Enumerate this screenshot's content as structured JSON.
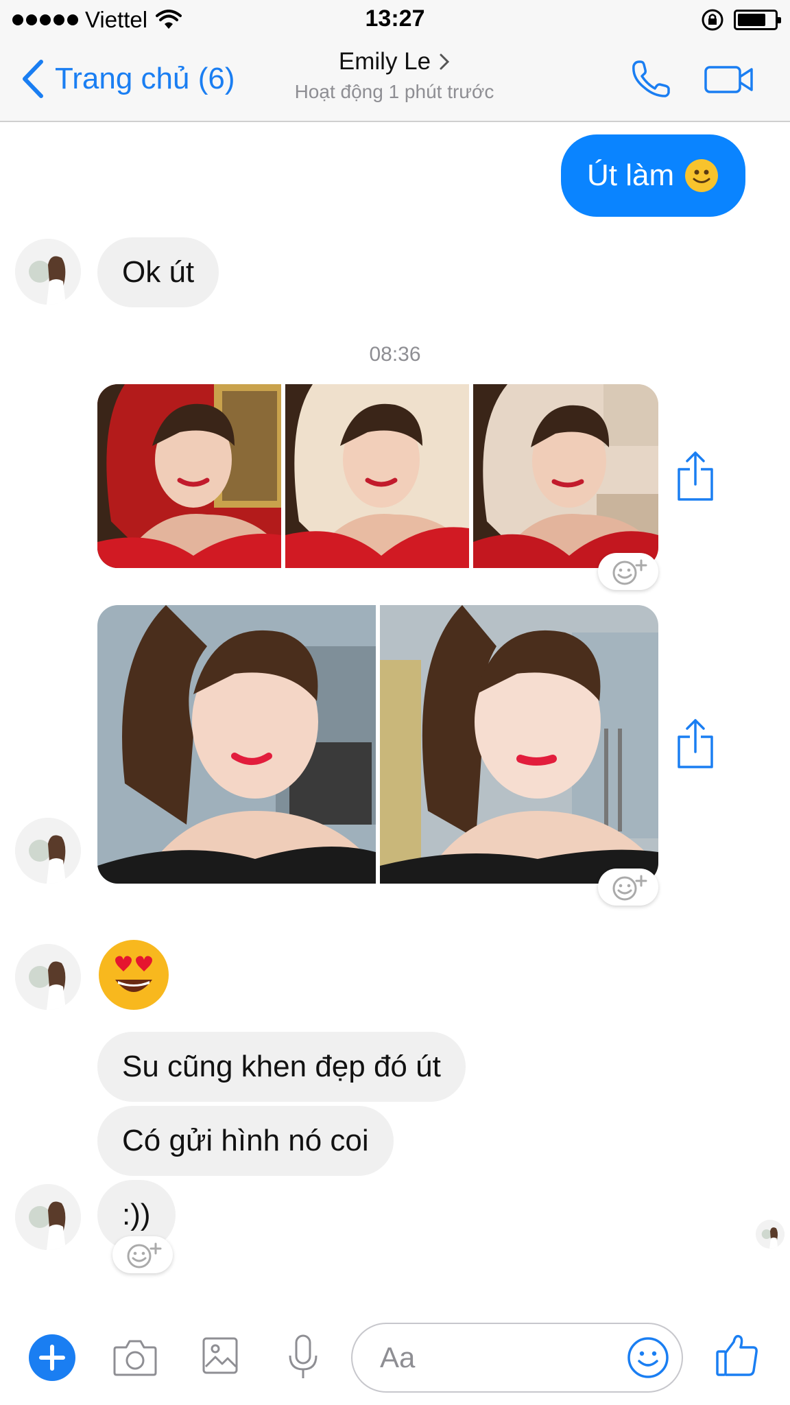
{
  "status_bar": {
    "carrier": "Viettel",
    "time": "13:27"
  },
  "nav": {
    "back_label": "Trang chủ (6)",
    "contact_name": "Emily Le",
    "contact_status": "Hoạt động 1 phút trước"
  },
  "messages": {
    "out_1": "Út làm",
    "in_1": "Ok út",
    "timestamp": "08:36",
    "in_2": "Su cũng khen đẹp đó út",
    "in_3": "Có gửi hình nó coi",
    "in_4": ":))"
  },
  "composer": {
    "placeholder": "Aa"
  },
  "icons": {
    "back": "chevron-left-icon",
    "call": "phone-icon",
    "video": "video-camera-icon",
    "share": "share-icon",
    "react": "add-reaction-icon",
    "plus": "plus-icon",
    "camera": "camera-icon",
    "gallery": "image-icon",
    "mic": "microphone-icon",
    "emoji": "smiley-icon",
    "like": "thumbs-up-icon"
  },
  "colors": {
    "accent": "#1a7ef2",
    "outgoing_bubble": "#0a84ff",
    "incoming_bubble": "#f0f0f0"
  }
}
